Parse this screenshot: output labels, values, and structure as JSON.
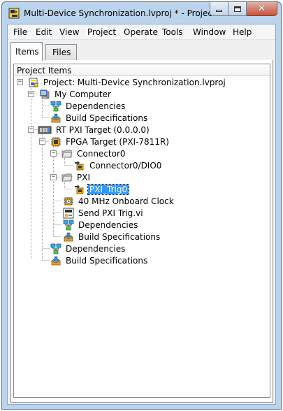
{
  "window": {
    "title": "Multi-Device Synchronization.lvproj * - Project..."
  },
  "menu": [
    "File",
    "Edit",
    "View",
    "Project",
    "Operate",
    "Tools",
    "Window",
    "Help"
  ],
  "tabs": [
    {
      "label": "Items",
      "active": true
    },
    {
      "label": "Files",
      "active": false
    }
  ],
  "tree": {
    "header": "Project Items",
    "selected_color": "#3399ff",
    "items": [
      {
        "label": "Project: Multi-Device Synchronization.lvproj",
        "icon": "project-icon",
        "expanded": true
      },
      {
        "label": "My Computer",
        "icon": "computer-icon",
        "expanded": true
      },
      {
        "label": "Dependencies",
        "icon": "dependencies-icon"
      },
      {
        "label": "Build Specifications",
        "icon": "build-specifications-icon"
      },
      {
        "label": "RT PXI Target (0.0.0.0)",
        "icon": "rt-target-icon",
        "expanded": true
      },
      {
        "label": "FPGA Target (PXI-7811R)",
        "icon": "fpga-target-icon",
        "expanded": true
      },
      {
        "label": "Connector0",
        "icon": "folder-icon",
        "expanded": true
      },
      {
        "label": "Connector0/DIO0",
        "icon": "io-item-icon"
      },
      {
        "label": "PXI",
        "icon": "folder-icon",
        "expanded": true
      },
      {
        "label": "PXI_Trig0",
        "icon": "io-item-icon",
        "selected": true
      },
      {
        "label": "40 MHz Onboard Clock",
        "icon": "clock-icon"
      },
      {
        "label": "Send PXI Trig.vi",
        "icon": "vi-icon"
      },
      {
        "label": "Dependencies",
        "icon": "dependencies-icon"
      },
      {
        "label": "Build Specifications",
        "icon": "build-specifications-icon"
      },
      {
        "label": "Dependencies",
        "icon": "dependencies-icon"
      },
      {
        "label": "Build Specifications",
        "icon": "build-specifications-icon"
      }
    ]
  }
}
